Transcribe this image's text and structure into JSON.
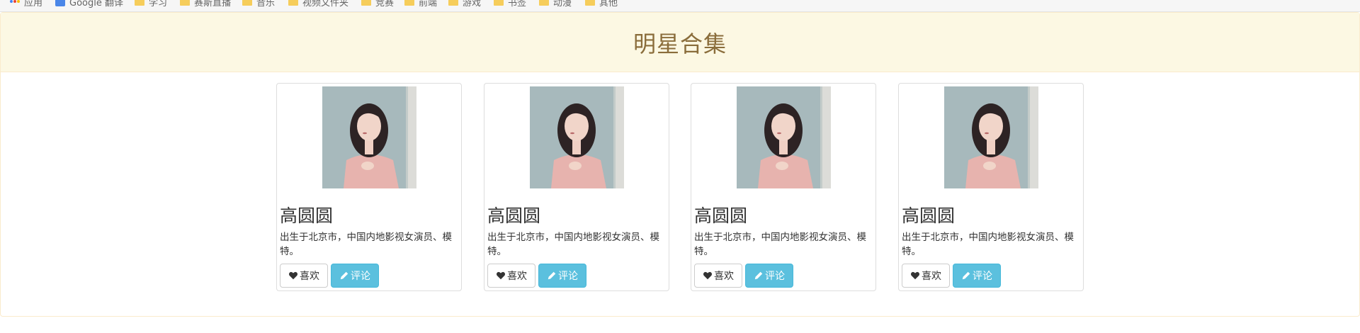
{
  "bookmarks": [
    {
      "label": "应用",
      "icon": "apps-icon"
    },
    {
      "label": "Google 翻译",
      "icon": "google-translate-icon"
    },
    {
      "label": "学习",
      "icon": "folder-icon"
    },
    {
      "label": "赛斯直播",
      "icon": "folder-icon"
    },
    {
      "label": "音乐",
      "icon": "folder-icon"
    },
    {
      "label": "视频文件夹",
      "icon": "folder-icon"
    },
    {
      "label": "竞赛",
      "icon": "folder-icon"
    },
    {
      "label": "前端",
      "icon": "folder-icon"
    },
    {
      "label": "游戏",
      "icon": "folder-icon"
    },
    {
      "label": "书签",
      "icon": "folder-icon"
    },
    {
      "label": "动漫",
      "icon": "folder-icon"
    },
    {
      "label": "其他",
      "icon": "folder-icon"
    }
  ],
  "panel": {
    "title": "明星合集"
  },
  "cards": [
    {
      "name": "高圆圆",
      "description": "出生于北京市，中国内地影视女演员、模特。",
      "like_label": "喜欢",
      "comment_label": "评论"
    },
    {
      "name": "高圆圆",
      "description": "出生于北京市，中国内地影视女演员、模特。",
      "like_label": "喜欢",
      "comment_label": "评论"
    },
    {
      "name": "高圆圆",
      "description": "出生于北京市，中国内地影视女演员、模特。",
      "like_label": "喜欢",
      "comment_label": "评论"
    },
    {
      "name": "高圆圆",
      "description": "出生于北京市，中国内地影视女演员、模特。",
      "like_label": "喜欢",
      "comment_label": "评论"
    }
  ],
  "colors": {
    "panel_heading_bg": "#fcf8e3",
    "panel_title": "#8a6d3b",
    "info_button": "#5bc0de"
  }
}
